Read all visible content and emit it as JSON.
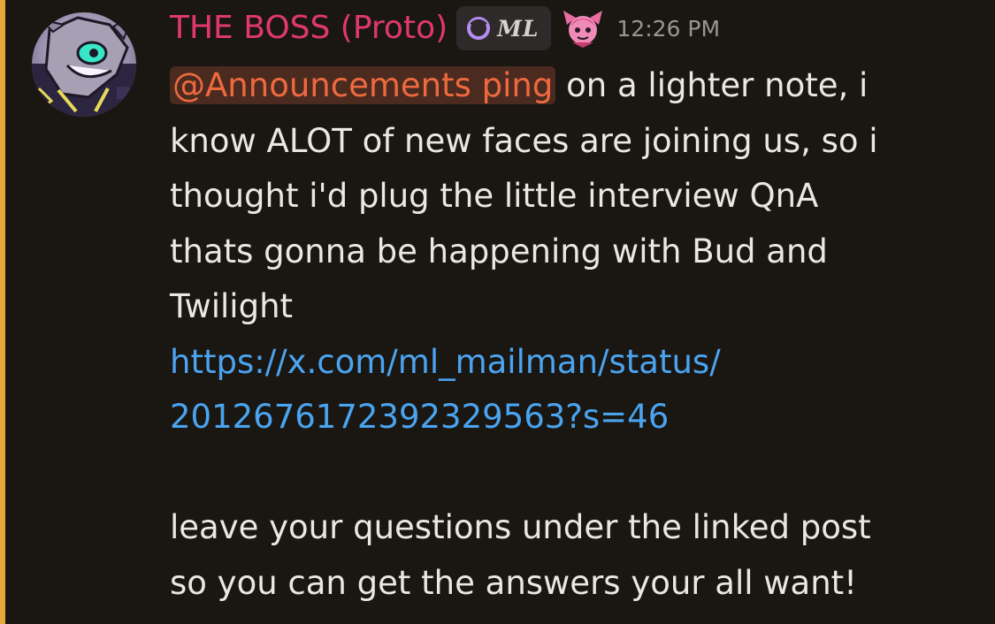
{
  "message": {
    "author": "THE BOSS (Proto)",
    "tag": "ML",
    "timestamp": "12:26 PM",
    "mention": "@Announcements ping",
    "line1_rest": " on a lighter note, i",
    "line2": "know ALOT of new faces are joining us, so i",
    "line3": "thought i'd plug the little interview QnA",
    "line4": "thats gonna be happening with Bud and",
    "line5": "Twilight",
    "link_line1": "https://x.com/ml_mailman/status/",
    "link_line2": "2012676172392329563?s=46",
    "line7": "leave your questions under the linked post",
    "line8": "so you can get the answers your all want!"
  },
  "colors": {
    "background": "#1a1612",
    "highlight_bar": "#e3a93a",
    "username": "#e0386e",
    "mention_text": "#ee6a3e",
    "mention_bg": "#4b2a20",
    "link": "#4aa4f0",
    "text": "#ebe8e3",
    "timestamp": "#9a968f"
  },
  "icons": {
    "avatar": "character-avatar",
    "tag_icon": "purple-ring-icon",
    "role_icon": "pink-character-role-icon"
  }
}
